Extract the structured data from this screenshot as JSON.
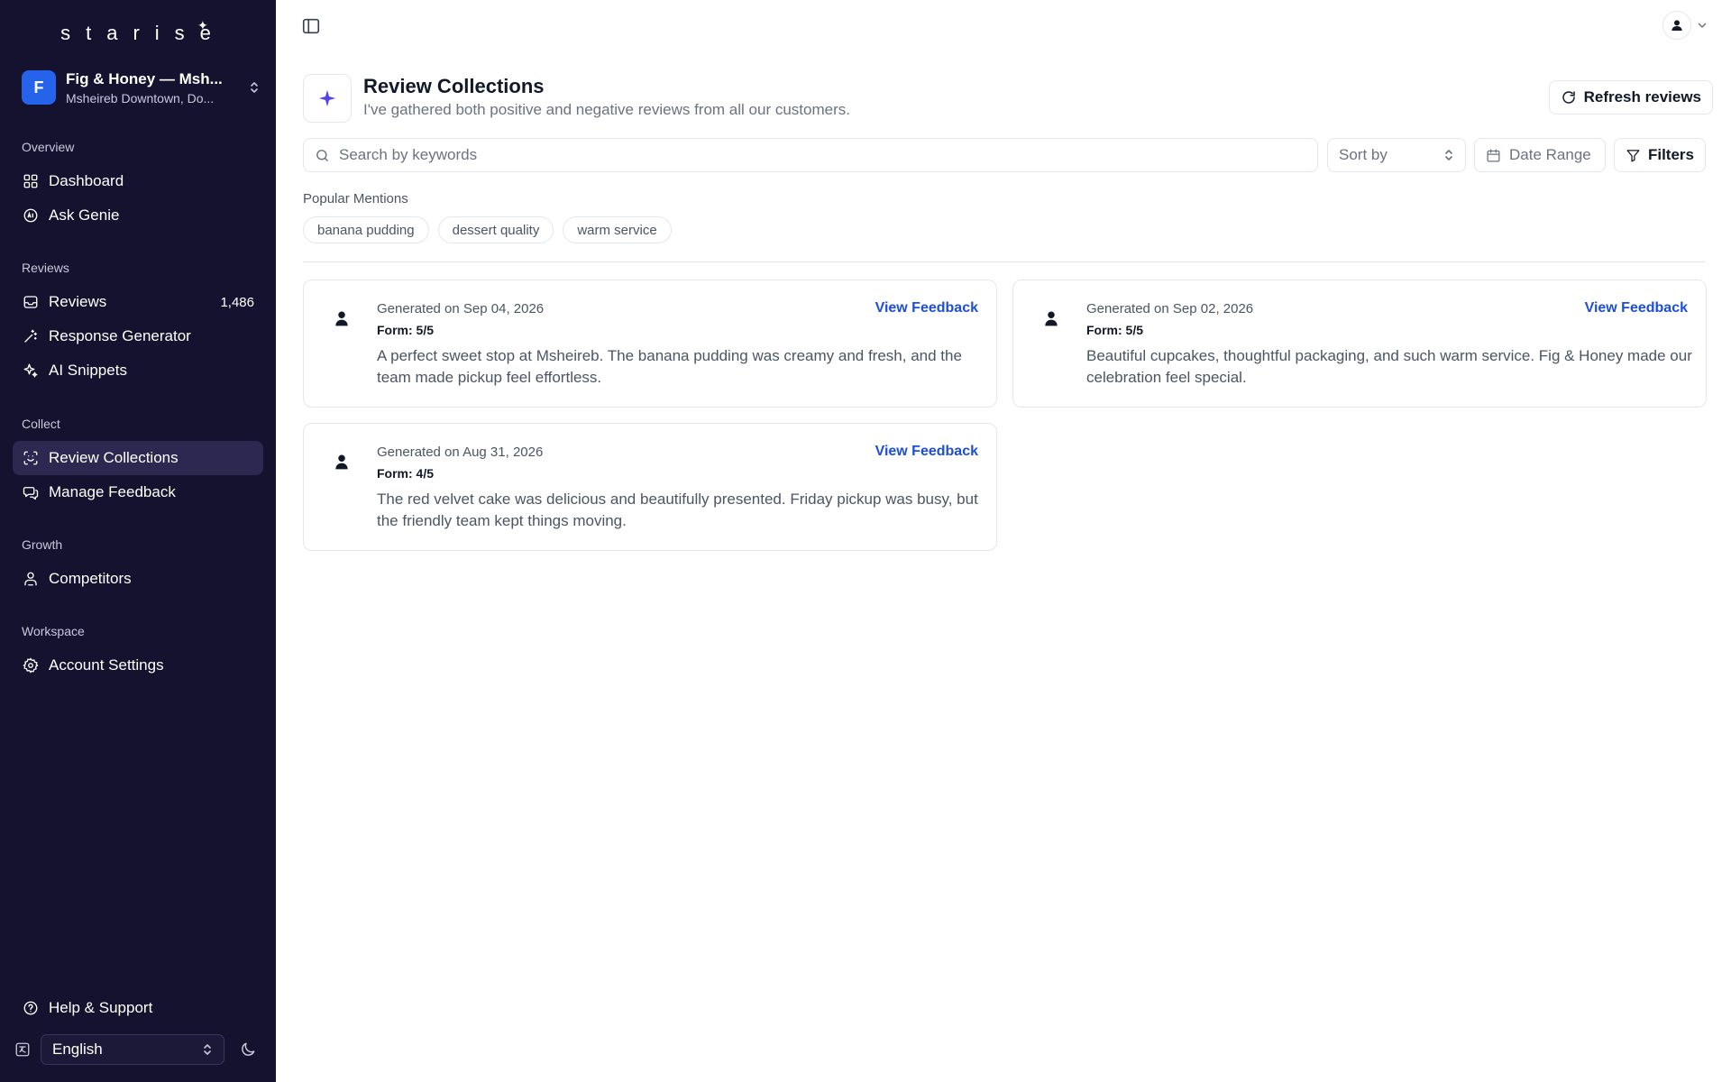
{
  "brand": {
    "logo_text": "starise",
    "logo_star": "✦"
  },
  "account": {
    "initial": "F",
    "name": "Fig & Honey — Msh...",
    "location": "Msheireb Downtown, Do..."
  },
  "sidebar": {
    "sections": {
      "overview": "Overview",
      "reviews": "Reviews",
      "collect": "Collect",
      "growth": "Growth",
      "workspace": "Workspace"
    },
    "items": {
      "dashboard": "Dashboard",
      "ask_genie": "Ask Genie",
      "reviews": "Reviews",
      "reviews_count": "1,486",
      "response_generator": "Response Generator",
      "ai_snippets": "AI Snippets",
      "review_collections": "Review Collections",
      "manage_feedback": "Manage Feedback",
      "competitors": "Competitors",
      "account_settings": "Account Settings"
    },
    "help": "Help & Support",
    "language": "English"
  },
  "header": {
    "title": "Review Collections",
    "subtitle": "I've gathered both positive and negative reviews from all our customers.",
    "refresh_label": "Refresh reviews"
  },
  "toolbar": {
    "search_placeholder": "Search by keywords",
    "sort_label": "Sort by",
    "date_label": "Date Range",
    "filters_label": "Filters"
  },
  "mentions": {
    "label": "Popular Mentions",
    "chips": [
      "banana pudding",
      "dessert quality",
      "warm service"
    ]
  },
  "cards": [
    {
      "generated": "Generated on Sep 04, 2026",
      "form": "Form: 5/5",
      "text": "A perfect sweet stop at Msheireb. The banana pudding was creamy and fresh, and the team made pickup feel effortless.",
      "link": "View Feedback"
    },
    {
      "generated": "Generated on Sep 02, 2026",
      "form": "Form: 5/5",
      "text": "Beautiful cupcakes, thoughtful packaging, and such warm service. Fig & Honey made our celebration feel special.",
      "link": "View Feedback"
    },
    {
      "generated": "Generated on Aug 31, 2026",
      "form": "Form: 4/5",
      "text": "The red velvet cake was delicious and beautifully presented. Friday pickup was busy, but the friendly team kept things moving.",
      "link": "View Feedback"
    }
  ],
  "colors": {
    "sidebar_bg": "#15122f",
    "sidebar_active": "#2d2851",
    "accent_blue": "#2563eb",
    "link_blue": "#1d4ed8",
    "sparkle": "#4f46e5"
  },
  "icons": {
    "sidebar_toggle": "sidebar-toggle-icon",
    "user": "user-icon",
    "sparkle": "sparkle-icon",
    "refresh": "refresh-icon",
    "search": "search-icon",
    "calendar": "calendar-icon",
    "filter": "filter-icon"
  }
}
